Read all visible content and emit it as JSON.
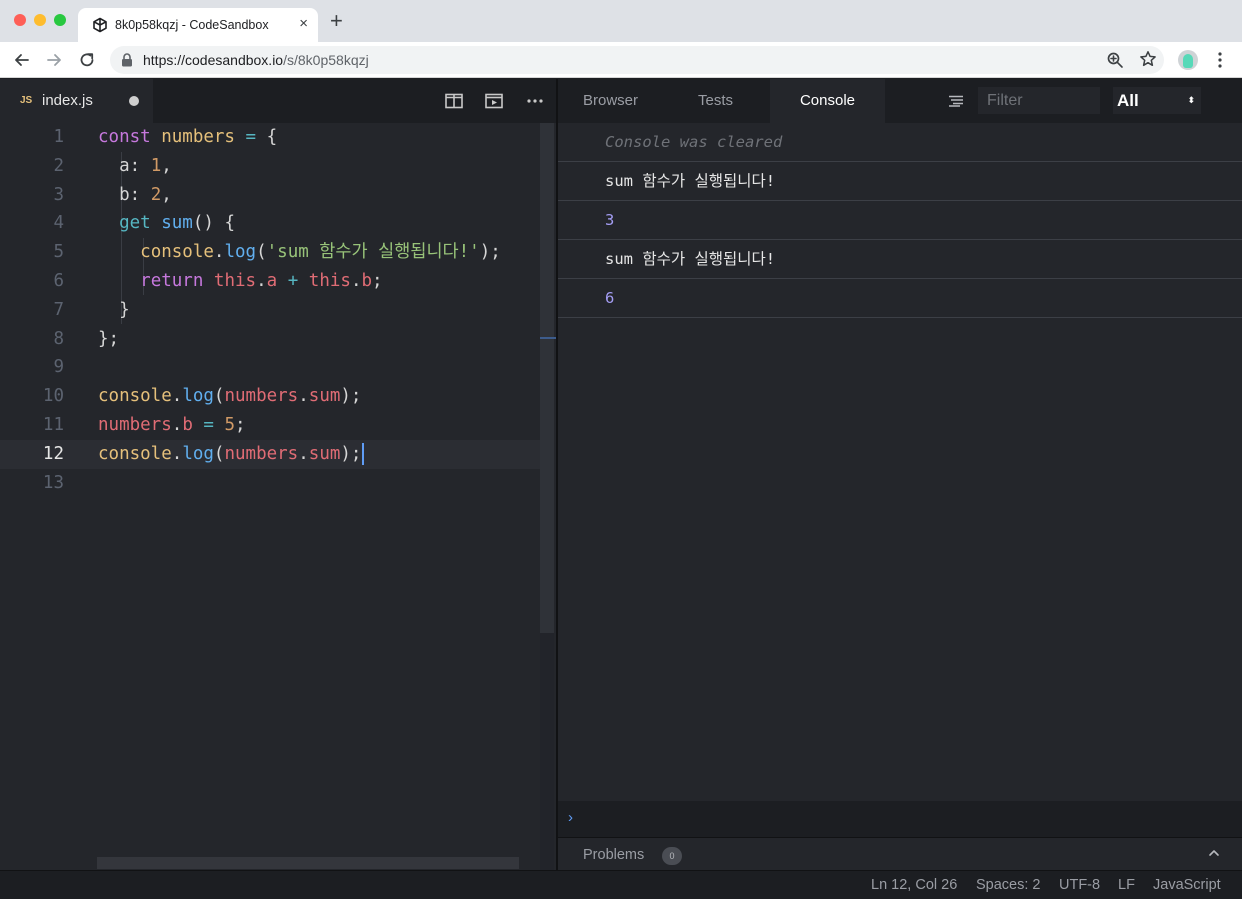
{
  "browser": {
    "tab_title": "8k0p58kqzj - CodeSandbox",
    "tab_close": "×",
    "new_tab": "+",
    "url_host": "https://codesandbox.io",
    "url_path": "/s/8k0p58kqzj"
  },
  "editor": {
    "file_badge": "JS",
    "file_name": "index.js",
    "lines": [
      {
        "n": "1",
        "tokens": [
          [
            "const ",
            "kw2"
          ],
          [
            "numbers",
            "var"
          ],
          [
            " = ",
            "op"
          ],
          [
            "{",
            "plain"
          ]
        ]
      },
      {
        "n": "2",
        "tokens": [
          [
            "  a",
            "plain"
          ],
          [
            ": ",
            "plain"
          ],
          [
            "1",
            "num"
          ],
          [
            ",",
            "plain"
          ]
        ]
      },
      {
        "n": "3",
        "tokens": [
          [
            "  b",
            "plain"
          ],
          [
            ": ",
            "plain"
          ],
          [
            "2",
            "num"
          ],
          [
            ",",
            "plain"
          ]
        ]
      },
      {
        "n": "4",
        "tokens": [
          [
            "  ",
            "plain"
          ],
          [
            "get ",
            "kb"
          ],
          [
            "sum",
            "fn"
          ],
          [
            "() {",
            "plain"
          ]
        ]
      },
      {
        "n": "5",
        "tokens": [
          [
            "    ",
            "plain"
          ],
          [
            "console",
            "var"
          ],
          [
            ".",
            "plain"
          ],
          [
            "log",
            "fn"
          ],
          [
            "(",
            "plain"
          ],
          [
            "'sum 함수가 실행됩니다!'",
            "str"
          ],
          [
            ");",
            "plain"
          ]
        ]
      },
      {
        "n": "6",
        "tokens": [
          [
            "    ",
            "plain"
          ],
          [
            "return ",
            "kw"
          ],
          [
            "this",
            "red"
          ],
          [
            ".",
            "plain"
          ],
          [
            "a",
            "red"
          ],
          [
            " + ",
            "op"
          ],
          [
            "this",
            "red"
          ],
          [
            ".",
            "plain"
          ],
          [
            "b",
            "red"
          ],
          [
            ";",
            "plain"
          ]
        ]
      },
      {
        "n": "7",
        "tokens": [
          [
            "  }",
            "plain"
          ]
        ]
      },
      {
        "n": "8",
        "tokens": [
          [
            "};",
            "plain"
          ]
        ]
      },
      {
        "n": "9",
        "tokens": []
      },
      {
        "n": "10",
        "tokens": [
          [
            "console",
            "var"
          ],
          [
            ".",
            "plain"
          ],
          [
            "log",
            "fn"
          ],
          [
            "(",
            "plain"
          ],
          [
            "numbers",
            "red"
          ],
          [
            ".",
            "plain"
          ],
          [
            "sum",
            "red"
          ],
          [
            ");",
            "plain"
          ]
        ]
      },
      {
        "n": "11",
        "tokens": [
          [
            "numbers",
            "red"
          ],
          [
            ".",
            "plain"
          ],
          [
            "b",
            "red"
          ],
          [
            " = ",
            "op"
          ],
          [
            "5",
            "num"
          ],
          [
            ";",
            "plain"
          ]
        ]
      },
      {
        "n": "12",
        "tokens": [
          [
            "console",
            "var"
          ],
          [
            ".",
            "plain"
          ],
          [
            "log",
            "fn"
          ],
          [
            "(",
            "plain"
          ],
          [
            "numbers",
            "red"
          ],
          [
            ".",
            "plain"
          ],
          [
            "sum",
            "red"
          ],
          [
            ");",
            "plain"
          ]
        ],
        "current": true
      },
      {
        "n": "13",
        "tokens": []
      }
    ]
  },
  "panel": {
    "tabs": [
      "Browser",
      "Tests",
      "Console"
    ],
    "active_tab": "Console",
    "filter_placeholder": "Filter",
    "level": "All",
    "level_caret": "⬍",
    "console": [
      {
        "text": "Console was cleared",
        "kind": "cleared"
      },
      {
        "text": "sum 함수가 실행됩니다!",
        "kind": "text"
      },
      {
        "text": "3",
        "kind": "num"
      },
      {
        "text": "sum 함수가 실행됩니다!",
        "kind": "text"
      },
      {
        "text": "6",
        "kind": "num"
      }
    ],
    "prompt": "›",
    "problems_label": "Problems",
    "problems_count": "0"
  },
  "status": {
    "position": "Ln 12, Col 26",
    "spaces": "Spaces: 2",
    "encoding": "UTF-8",
    "eol": "LF",
    "language": "JavaScript"
  },
  "colors": {
    "accent": "#5f9cf5",
    "editor_bg": "#24262b",
    "chrome_bg": "#1c1e22"
  }
}
